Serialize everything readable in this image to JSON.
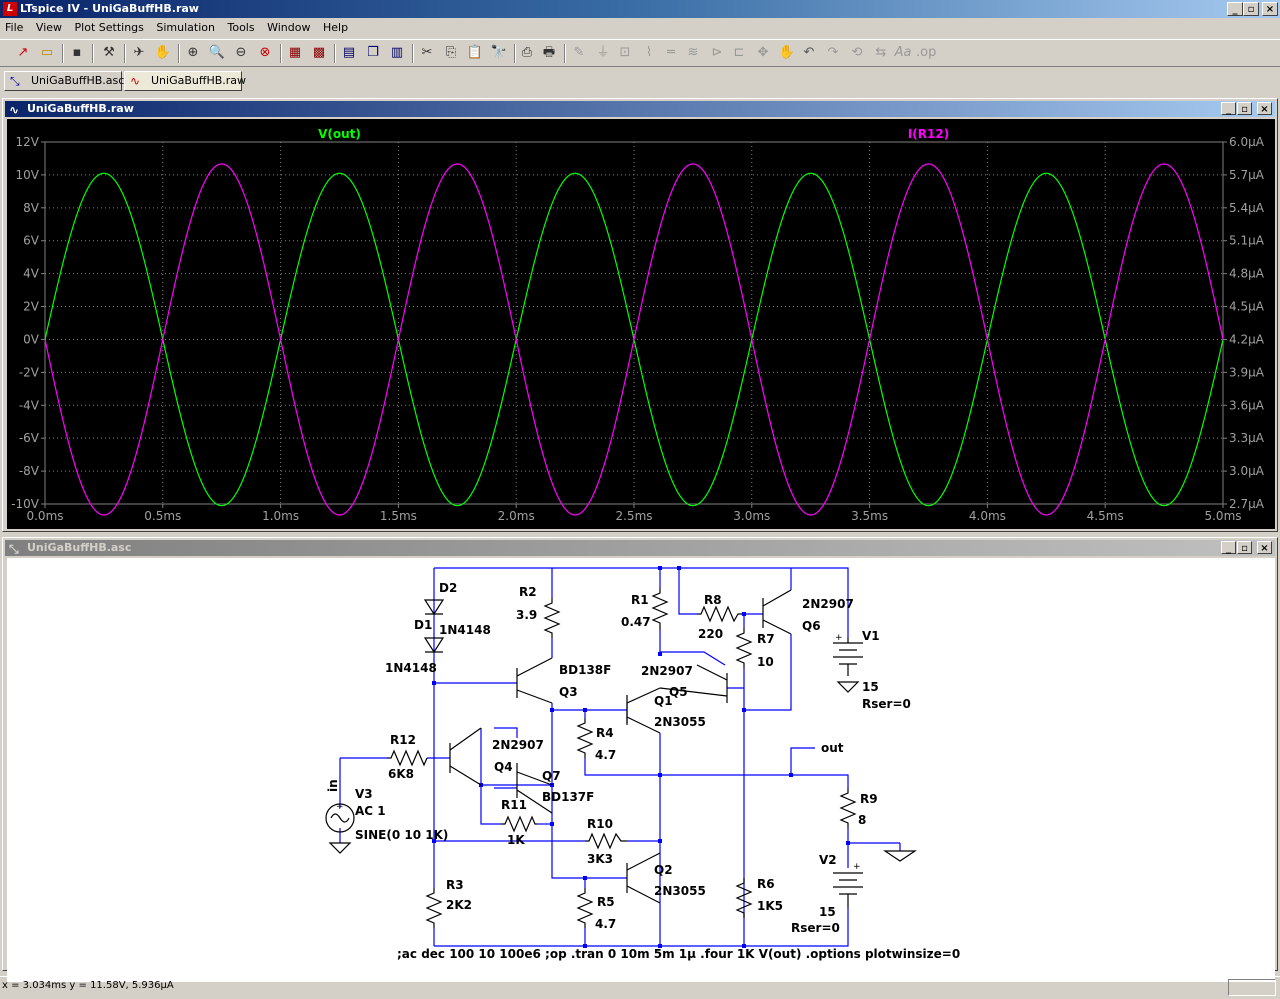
{
  "app": {
    "title": "LTspice IV - UniGaBuffHB.raw"
  },
  "menu": [
    "File",
    "View",
    "Plot Settings",
    "Simulation",
    "Tools",
    "Window",
    "Help"
  ],
  "tabs": [
    {
      "label": "UniGaBuffHB.asc",
      "icon": "schematic-icon"
    },
    {
      "label": "UniGaBuffHB.raw",
      "icon": "waveform-icon"
    }
  ],
  "plot_window": {
    "title": "UniGaBuffHB.raw"
  },
  "schematic_window": {
    "title": "UniGaBuffHB.asc"
  },
  "chart_data": {
    "type": "line",
    "series": [
      {
        "name": "V(out)",
        "color": "#00ff00",
        "axis": "left",
        "amplitude": 10.1,
        "offset": 0.0,
        "frequency_hz": 1000,
        "phase": "sine"
      },
      {
        "name": "I(R12)",
        "color": "#ff00ff",
        "axis": "right",
        "amplitude": 1.6,
        "offset": 4.2,
        "frequency_hz": 1000,
        "phase": "negative-sine"
      }
    ],
    "x_ticks": [
      "0.0ms",
      "0.5ms",
      "1.0ms",
      "1.5ms",
      "2.0ms",
      "2.5ms",
      "3.0ms",
      "3.5ms",
      "4.0ms",
      "4.5ms",
      "5.0ms"
    ],
    "y_left_ticks": [
      "12V",
      "10V",
      "8V",
      "6V",
      "4V",
      "2V",
      "0V",
      "-2V",
      "-4V",
      "-6V",
      "-8V",
      "-10V"
    ],
    "y_right_ticks": [
      "6.0µA",
      "5.7µA",
      "5.4µA",
      "5.1µA",
      "4.8µA",
      "4.5µA",
      "4.2µA",
      "3.9µA",
      "3.6µA",
      "3.3µA",
      "3.0µA",
      "2.7µA"
    ],
    "xlim": [
      0,
      5
    ],
    "ylim_left": [
      -10,
      12
    ],
    "ylim_right": [
      2.7,
      6.0
    ],
    "grid": true,
    "legend": "top"
  },
  "schematic": {
    "labels": {
      "D2": "D2",
      "D1": "D1",
      "D1_model": "1N4148",
      "D2_model": "1N4148",
      "R2": "R2",
      "R2_val": "3.9",
      "R1": "R1",
      "R1_val": "0.47",
      "R8": "R8",
      "R8_val": "220",
      "R7": "R7",
      "R7_val": "10",
      "Q6_model": "2N2907",
      "Q6": "Q6",
      "V1": "V1",
      "V1_val": "15",
      "V1_rser": "Rser=0",
      "Q3_model": "BD138F",
      "Q3": "Q3",
      "Q5_model": "2N2907",
      "Q1": "Q1",
      "Q5": "Q5",
      "Q1_model": "2N3055",
      "R12": "R12",
      "R12_val": "6K8",
      "Q4_model": "2N2907",
      "Q4": "Q4",
      "Q7": "Q7",
      "Q7_model": "BD137F",
      "R4": "R4",
      "R4_val": "4.7",
      "out": "out",
      "R9": "R9",
      "R9_val": "8",
      "in": "in",
      "V3": "V3",
      "V3_ac": "AC 1",
      "V3_sine": "SINE(0 10 1K)",
      "R11": "R11",
      "R11_val": "1K",
      "R10": "R10",
      "R10_val": "3K3",
      "Q2": "Q2",
      "Q2_model": "2N3055",
      "V2": "V2",
      "V2_val": "15",
      "V2_rser": "Rser=0",
      "R3": "R3",
      "R3_val": "2K2",
      "R5": "R5",
      "R5_val": "4.7",
      "R6": "R6",
      "R6_val": "1K5",
      "directives": ";ac dec 100 10 100e6 ;op  .tran 0 10m 5m 1µ .four 1K V(out)  .options plotwinsize=0"
    }
  },
  "status": {
    "readout": "x = 3.034ms    y = 11.58V, 5.936µA"
  },
  "colors": {
    "plot_bg": "#000000",
    "grid": "#808080",
    "trace1": "#00ff00",
    "trace2": "#ff00ff",
    "wire": "#0000ff",
    "component": "#000000"
  }
}
